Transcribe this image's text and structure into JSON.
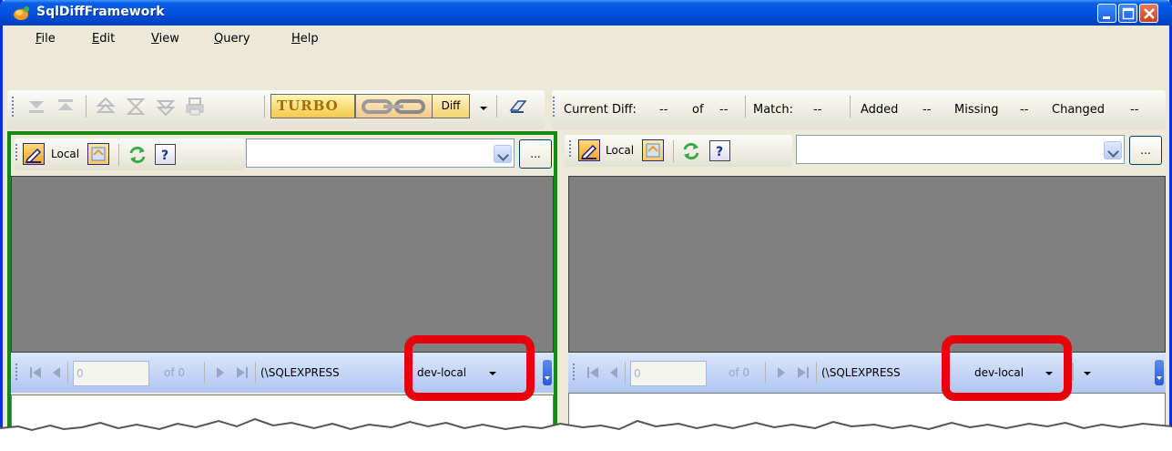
{
  "window": {
    "title": "SqlDiffFramework"
  },
  "menu": {
    "items": [
      {
        "pre": "",
        "u": "F",
        "post": "ile"
      },
      {
        "pre": "",
        "u": "E",
        "post": "dit"
      },
      {
        "pre": "",
        "u": "V",
        "post": "iew"
      },
      {
        "pre": "",
        "u": "Q",
        "post": "uery"
      },
      {
        "pre": "",
        "u": "H",
        "post": "elp"
      }
    ]
  },
  "toolbar": {
    "turbo_label": "TURBO",
    "diff_label": "Diff",
    "current_diff_label": "Current Diff:",
    "current_diff_value": "--",
    "of_label": "of",
    "of_value": "--",
    "match_label": "Match:",
    "match_value": "--",
    "added_label": "Added",
    "added_value": "--",
    "missing_label": "Missing",
    "missing_value": "--",
    "changed_label": "Changed",
    "changed_value": "--"
  },
  "left_pane": {
    "connection_label": "Local",
    "ellipsis_label": "...",
    "page_value": "0",
    "of_pages": "of 0",
    "server": "(\\SQLEXPRESS",
    "database": "dev-local"
  },
  "right_pane": {
    "connection_label": "Local",
    "ellipsis_label": "...",
    "page_value": "0",
    "of_pages": "of 0",
    "server": "(\\SQLEXPRESS",
    "database": "dev-local"
  },
  "colors": {
    "title_bar": "#0054e3",
    "highlight": "#e8000b",
    "active_pane_border": "#148a14",
    "grid_background": "#808080"
  }
}
